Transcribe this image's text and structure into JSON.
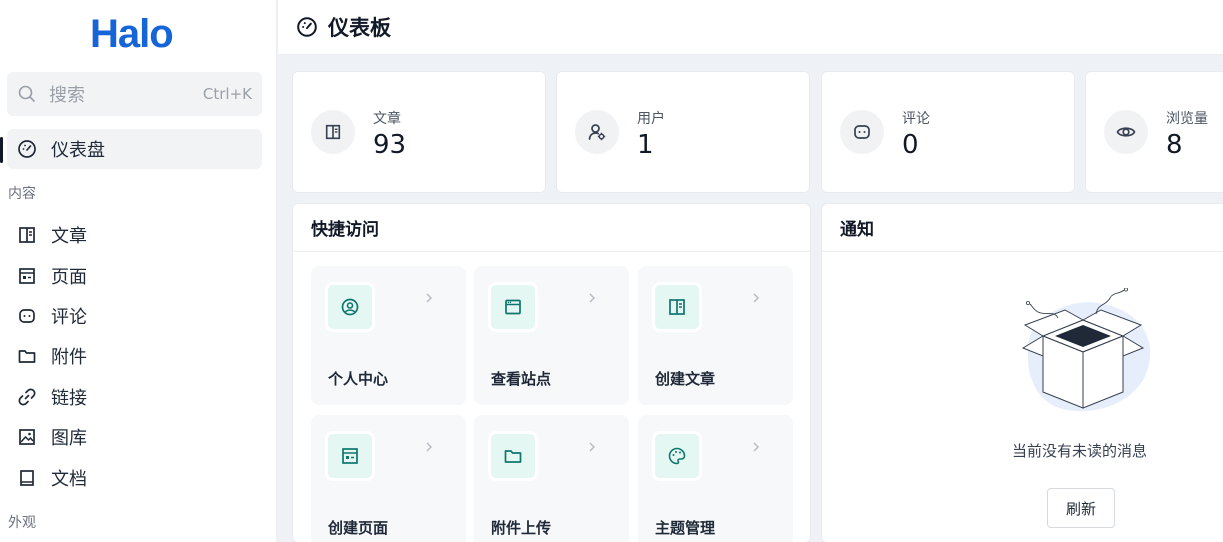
{
  "sidebar": {
    "logo": "Halo",
    "search": {
      "placeholder": "搜索",
      "shortcut": "Ctrl+K"
    },
    "dashboard_item": {
      "label": "仪表盘",
      "icon": "dashboard-icon"
    },
    "groups": [
      {
        "title": "内容"
      },
      {
        "title": "外观"
      }
    ],
    "content_items": [
      {
        "label": "文章",
        "icon": "book-icon"
      },
      {
        "label": "页面",
        "icon": "page-icon"
      },
      {
        "label": "评论",
        "icon": "comment-icon"
      },
      {
        "label": "附件",
        "icon": "folder-icon"
      },
      {
        "label": "链接",
        "icon": "link-icon"
      },
      {
        "label": "图库",
        "icon": "image-icon"
      },
      {
        "label": "文档",
        "icon": "document-icon"
      }
    ]
  },
  "header": {
    "title": "仪表板",
    "icon": "dashboard-icon"
  },
  "stats": [
    {
      "label": "文章",
      "value": "93",
      "icon": "book-icon"
    },
    {
      "label": "用户",
      "value": "1",
      "icon": "user-settings-icon"
    },
    {
      "label": "评论",
      "value": "0",
      "icon": "comment-icon"
    },
    {
      "label": "浏览量",
      "value": "8",
      "icon": "eye-icon"
    }
  ],
  "quick_access": {
    "title": "快捷访问",
    "items": [
      {
        "label": "个人中心",
        "icon": "user-circle-icon"
      },
      {
        "label": "查看站点",
        "icon": "browser-window-icon"
      },
      {
        "label": "创建文章",
        "icon": "book-icon"
      },
      {
        "label": "创建页面",
        "icon": "page-icon"
      },
      {
        "label": "附件上传",
        "icon": "folder-icon"
      },
      {
        "label": "主题管理",
        "icon": "palette-icon"
      }
    ]
  },
  "notifications": {
    "title": "通知",
    "empty_text": "当前没有未读的消息",
    "refresh_label": "刷新"
  },
  "colors": {
    "brand": "#1565d8",
    "accent_green": "#0f766e",
    "tile_icon_bg": "#e4f7f2",
    "page_bg": "#eef2f6"
  }
}
